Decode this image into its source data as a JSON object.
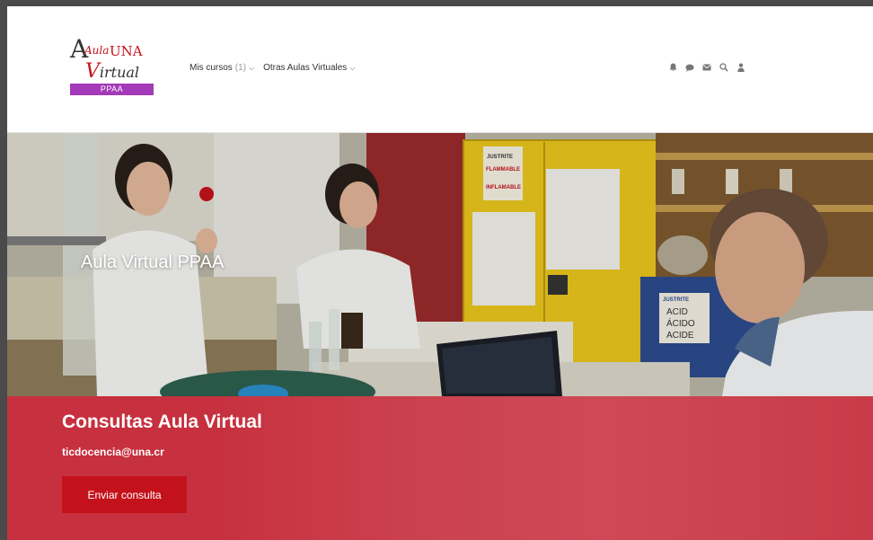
{
  "logo": {
    "aula": "Aula",
    "una": "UNA",
    "big_letter": "A",
    "virtual_v": "V",
    "virtual_rest": "irtual",
    "bar_text": "PPAA"
  },
  "nav": {
    "items": [
      {
        "label": "Mis cursos",
        "count": "(1)"
      },
      {
        "label": "Otras Aulas Virtuales",
        "count": ""
      }
    ]
  },
  "header_icons": [
    "bell-icon",
    "chat-icon",
    "envelope-icon",
    "search-icon",
    "user-icon"
  ],
  "hero": {
    "title": "Aula Virtual PPAA",
    "cabinet_labels": {
      "justrite": "JUSTRITE",
      "flammable1": "FLAMMABLE",
      "flammable2": "INFLAMABLE",
      "acid1": "ACID",
      "acid2": "ÁCIDO",
      "acid3": "ACIDE"
    }
  },
  "contact": {
    "heading": "Consultas Aula Virtual",
    "email": "ticdocencia@una.cr",
    "button": "Enviar consulta"
  },
  "colors": {
    "brand_red": "#c4121c",
    "band": "#c7303e",
    "logo_bar": "#a43ab8"
  }
}
